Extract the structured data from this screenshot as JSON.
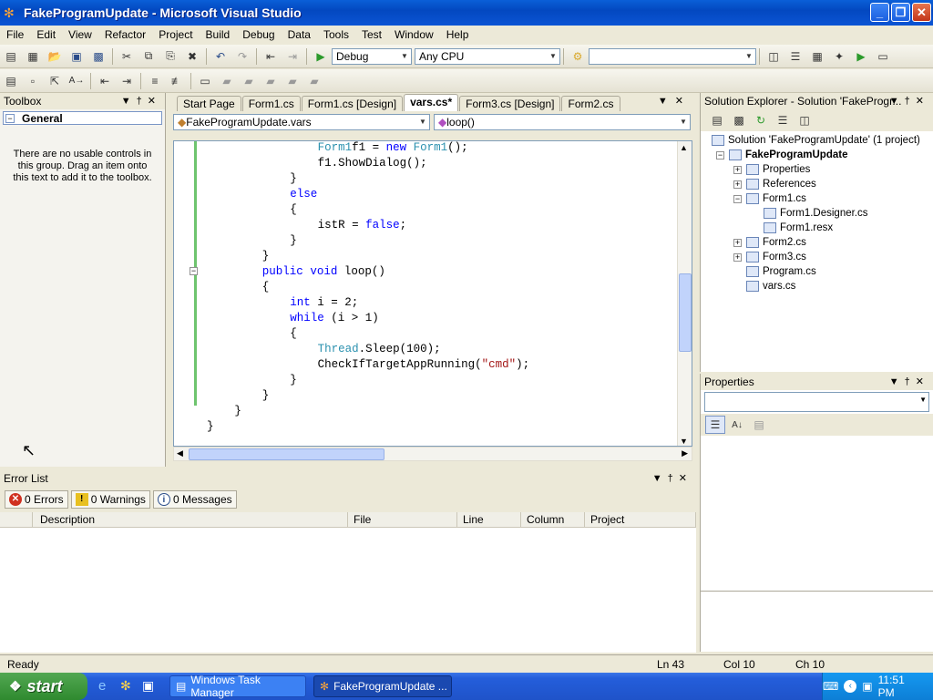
{
  "window": {
    "title": "FakeProgramUpdate - Microsoft Visual Studio"
  },
  "menu": [
    "File",
    "Edit",
    "View",
    "Refactor",
    "Project",
    "Build",
    "Debug",
    "Data",
    "Tools",
    "Test",
    "Window",
    "Help"
  ],
  "toolbar": {
    "config": "Debug",
    "platform": "Any CPU",
    "find": ""
  },
  "toolbox": {
    "title": "Toolbox",
    "group": "General",
    "message": "There are no usable controls in this group. Drag an item onto this text to add it to the toolbox."
  },
  "tabs": [
    "Start Page",
    "Form1.cs",
    "Form1.cs [Design]",
    "vars.cs*",
    "Form3.cs [Design]",
    "Form2.cs"
  ],
  "nav": {
    "class": "FakeProgramUpdate.vars",
    "member": "loop()"
  },
  "code": [
    {
      "indent": 8,
      "parts": [
        [
          "ty",
          "Form1"
        ],
        [
          "",
          "f1 = "
        ],
        [
          "kw",
          "new"
        ],
        [
          "",
          " "
        ],
        [
          "ty",
          "Form1"
        ],
        [
          "",
          "();"
        ]
      ]
    },
    {
      "indent": 8,
      "parts": [
        [
          "",
          "f1.ShowDialog();"
        ]
      ]
    },
    {
      "indent": 6,
      "parts": [
        [
          "",
          "}"
        ]
      ]
    },
    {
      "indent": 6,
      "parts": [
        [
          "kw",
          "else"
        ]
      ]
    },
    {
      "indent": 6,
      "parts": [
        [
          "",
          "{"
        ]
      ]
    },
    {
      "indent": 8,
      "parts": [
        [
          "",
          "istR = "
        ],
        [
          "kw",
          "false"
        ],
        [
          "",
          ";"
        ]
      ]
    },
    {
      "indent": 6,
      "parts": [
        [
          "",
          "}"
        ]
      ]
    },
    {
      "indent": 4,
      "parts": [
        [
          "",
          "}"
        ]
      ]
    },
    {
      "indent": 4,
      "parts": [
        [
          "kw",
          "public"
        ],
        [
          "",
          " "
        ],
        [
          "kw",
          "void"
        ],
        [
          "",
          " loop()"
        ]
      ]
    },
    {
      "indent": 4,
      "parts": [
        [
          "",
          "{"
        ]
      ]
    },
    {
      "indent": 6,
      "parts": [
        [
          "kw",
          "int"
        ],
        [
          "",
          " i = 2;"
        ]
      ]
    },
    {
      "indent": 6,
      "parts": [
        [
          "kw",
          "while"
        ],
        [
          "",
          " (i > 1)"
        ]
      ]
    },
    {
      "indent": 6,
      "parts": [
        [
          "",
          "{"
        ]
      ]
    },
    {
      "indent": 8,
      "parts": [
        [
          "ty",
          "Thread"
        ],
        [
          "",
          ".Sleep(100);"
        ]
      ]
    },
    {
      "indent": 8,
      "parts": [
        [
          "",
          "CheckIfTargetAppRunning("
        ],
        [
          "st",
          "\"cmd\""
        ],
        [
          "",
          ");"
        ]
      ]
    },
    {
      "indent": 6,
      "parts": [
        [
          "",
          "}"
        ]
      ]
    },
    {
      "indent": 4,
      "parts": [
        [
          "",
          "}"
        ]
      ]
    },
    {
      "indent": 2,
      "parts": [
        [
          "",
          "}"
        ]
      ]
    },
    {
      "indent": 0,
      "parts": [
        [
          "",
          "}"
        ]
      ]
    }
  ],
  "solution": {
    "title": "Solution Explorer - Solution 'FakeProgr...",
    "items": [
      {
        "label": "Solution 'FakeProgramUpdate' (1 project)",
        "level": 0,
        "bold": false,
        "exp": ""
      },
      {
        "label": "FakeProgramUpdate",
        "level": 1,
        "bold": true,
        "exp": "-"
      },
      {
        "label": "Properties",
        "level": 2,
        "bold": false,
        "exp": "+"
      },
      {
        "label": "References",
        "level": 2,
        "bold": false,
        "exp": "+"
      },
      {
        "label": "Form1.cs",
        "level": 2,
        "bold": false,
        "exp": "-"
      },
      {
        "label": "Form1.Designer.cs",
        "level": 3,
        "bold": false,
        "exp": ""
      },
      {
        "label": "Form1.resx",
        "level": 3,
        "bold": false,
        "exp": ""
      },
      {
        "label": "Form2.cs",
        "level": 2,
        "bold": false,
        "exp": "+"
      },
      {
        "label": "Form3.cs",
        "level": 2,
        "bold": false,
        "exp": "+"
      },
      {
        "label": "Program.cs",
        "level": 2,
        "bold": false,
        "exp": ""
      },
      {
        "label": "vars.cs",
        "level": 2,
        "bold": false,
        "exp": ""
      }
    ]
  },
  "properties": {
    "title": "Properties"
  },
  "errorlist": {
    "title": "Error List",
    "errors": "0 Errors",
    "warnings": "0 Warnings",
    "messages": "0 Messages",
    "columns": [
      "Description",
      "File",
      "Line",
      "Column",
      "Project"
    ]
  },
  "status": {
    "text": "Ready",
    "ln": "Ln 43",
    "col": "Col 10",
    "ch": "Ch 10"
  },
  "taskbar": {
    "start": "start",
    "task1": "Windows Task Manager",
    "task2": "FakeProgramUpdate ...",
    "clock": "11:51 PM"
  }
}
